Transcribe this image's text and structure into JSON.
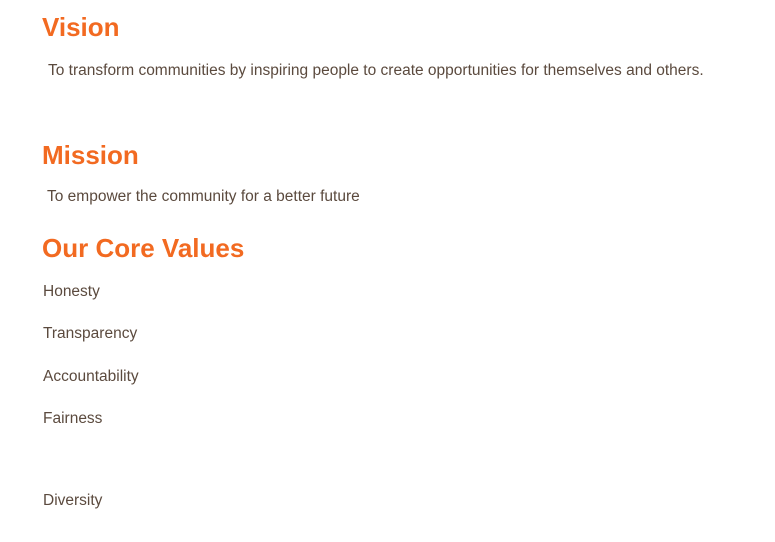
{
  "vision": {
    "heading": "Vision",
    "text": "To transform communities by inspiring people to create opportunities for themselves and others."
  },
  "mission": {
    "heading": "Mission",
    "text": "To empower the community for a better future"
  },
  "core_values": {
    "heading": "Our Core Values",
    "items": [
      "Honesty",
      "Transparency",
      "Accountability",
      "Fairness",
      "Diversity"
    ]
  },
  "colors": {
    "heading": "#f26a21",
    "body_text": "#5b4a3e",
    "background": "#ffffff"
  }
}
